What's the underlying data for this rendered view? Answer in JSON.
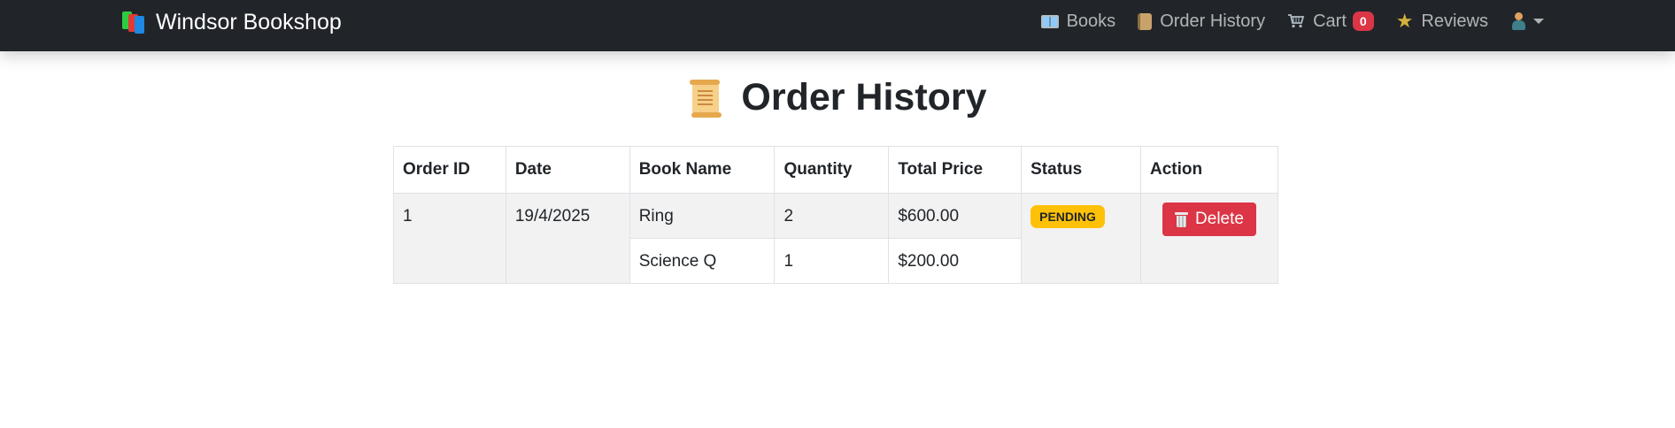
{
  "navbar": {
    "brand": "Windsor Bookshop",
    "items": [
      {
        "label": "Books",
        "icon": "book-icon"
      },
      {
        "label": "Order History",
        "icon": "scroll-icon"
      },
      {
        "label": "Cart",
        "icon": "cart-icon",
        "badge": "0"
      },
      {
        "label": "Reviews",
        "icon": "star-icon"
      }
    ],
    "user_icon": "user-icon"
  },
  "page": {
    "title": "Order History",
    "title_icon": "scroll-icon"
  },
  "table": {
    "headers": [
      "Order ID",
      "Date",
      "Book Name",
      "Quantity",
      "Total Price",
      "Status",
      "Action"
    ],
    "orders": [
      {
        "order_id": "1",
        "date": "19/4/2025",
        "items": [
          {
            "book_name": "Ring",
            "quantity": "2",
            "total_price": "$600.00"
          },
          {
            "book_name": "Science Q",
            "quantity": "1",
            "total_price": "$200.00"
          }
        ],
        "status": "PENDING",
        "action_label": "Delete"
      }
    ]
  },
  "colors": {
    "navbar_bg": "#212529",
    "danger": "#dc3545",
    "warning": "#ffc107"
  }
}
